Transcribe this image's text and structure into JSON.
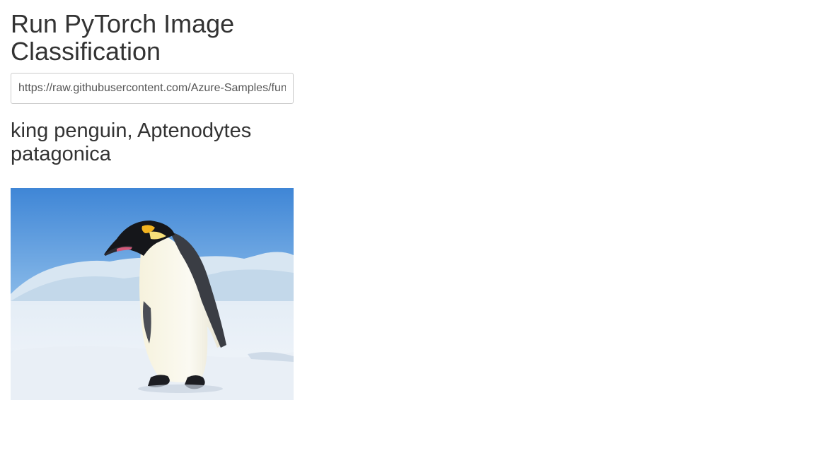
{
  "page": {
    "title": "Run PyTorch Image Classification"
  },
  "form": {
    "url_value": "https://raw.githubusercontent.com/Azure-Samples/functions-python-pytorch-tutorial/master/resources/assets/penguin.jpg"
  },
  "result": {
    "prediction": "king penguin, Aptenodytes patagonica"
  },
  "colors": {
    "text": "#333333",
    "input_border": "#cccccc",
    "sky_top": "#4a90d9",
    "snow": "#f2f5f9"
  }
}
